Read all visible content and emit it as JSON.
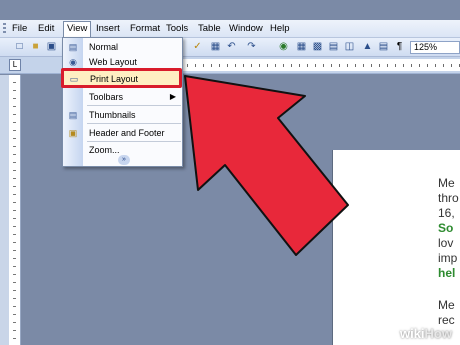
{
  "menubar": {
    "items": [
      "File",
      "Edit",
      "View",
      "Insert",
      "Format",
      "Tools",
      "Table",
      "Window",
      "Help"
    ]
  },
  "toolbar": {
    "zoom": "125%",
    "icons": [
      "new-icon",
      "open-icon",
      "save-icon",
      "undo-icon",
      "redo-icon",
      "hyperlink-icon",
      "table-icon",
      "paragraph-icon"
    ]
  },
  "ruler": {
    "tab_selector": "L"
  },
  "view_menu": {
    "items": [
      {
        "label": "Normal",
        "icon": "normal-view-icon"
      },
      {
        "label": "Web Layout",
        "icon": "web-layout-icon"
      },
      {
        "label": "Print Layout",
        "icon": "print-layout-icon",
        "highlighted": true
      },
      {
        "label": "Toolbars",
        "icon": "",
        "submenu": true
      },
      {
        "label": "Thumbnails",
        "icon": "thumbnails-icon"
      },
      {
        "label": "Header and Footer",
        "icon": "header-footer-icon"
      },
      {
        "label": "Zoom...",
        "icon": ""
      }
    ],
    "more_icon": "expand-more-icon"
  },
  "document": {
    "lines": [
      {
        "text": "Me",
        "color": "#333333"
      },
      {
        "text": "thro",
        "color": "#333333"
      },
      {
        "text": "16,",
        "color": "#333333"
      },
      {
        "text": "So",
        "color": "#2e8b30"
      },
      {
        "text": "lov",
        "color": "#333333"
      },
      {
        "text": "imp",
        "color": "#333333"
      },
      {
        "text": "hel",
        "color": "#2e8b30"
      },
      {
        "text": "Me",
        "color": "#333333"
      },
      {
        "text": "rec",
        "color": "#333333"
      }
    ]
  },
  "annotation": {
    "arrow_color": "#e8283a",
    "highlight_color": "#d91b2c"
  },
  "watermark": {
    "wiki": "wiki",
    "how": "How"
  }
}
